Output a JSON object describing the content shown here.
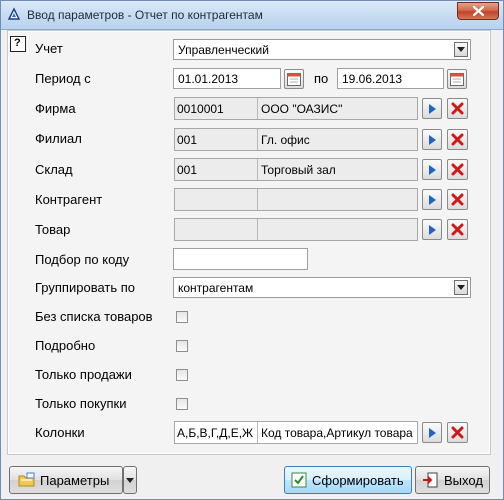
{
  "window": {
    "title": "Ввод параметров - Отчет по контрагентам",
    "help_glyph": "?"
  },
  "fields": {
    "uchet": {
      "label": "Учет",
      "value": "Управленческий"
    },
    "period": {
      "label": "Период с",
      "from": "01.01.2013",
      "to_label": "по",
      "to": "19.06.2013"
    },
    "firma": {
      "label": "Фирма",
      "code": "0010001",
      "name": "ООО \"ОАЗИС\""
    },
    "filial": {
      "label": "Филиал",
      "code": "001",
      "name": "Гл. офис"
    },
    "sklad": {
      "label": "Склад",
      "code": "001",
      "name": "Торговый зал"
    },
    "kontragent": {
      "label": "Контрагент",
      "code": "",
      "name": ""
    },
    "tovar": {
      "label": "Товар",
      "code": "",
      "name": ""
    },
    "podbor": {
      "label": "Подбор по коду",
      "value": ""
    },
    "group_by": {
      "label": "Группировать по",
      "value": "контрагентам"
    },
    "bez_spiska": {
      "label": "Без списка товаров",
      "checked": false
    },
    "podrobno": {
      "label": "Подробно",
      "checked": false
    },
    "tolko_prodazhi": {
      "label": "Только продажи",
      "checked": false
    },
    "tolko_pokupki": {
      "label": "Только покупки",
      "checked": false
    },
    "kolonki": {
      "label": "Колонки",
      "code": "А,Б,В,Г,Д,Е,Ж",
      "name": "Код товара,Артикул товара"
    }
  },
  "buttons": {
    "params": "Параметры",
    "generate": "Сформировать",
    "exit": "Выход"
  },
  "colors": {
    "pick_arrow": "#1f63c6",
    "clear_x": "#d01818"
  }
}
